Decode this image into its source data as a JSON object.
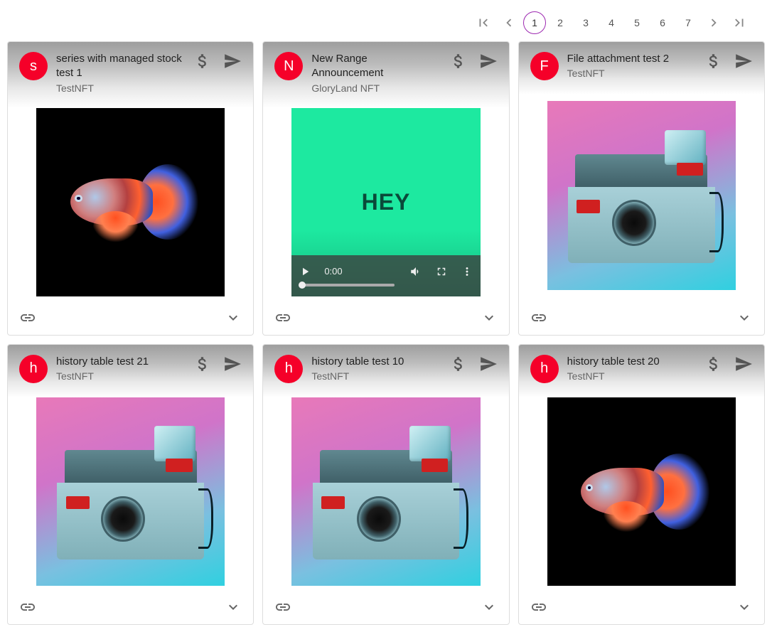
{
  "pagination": {
    "pages": [
      "1",
      "2",
      "3",
      "4",
      "5",
      "6",
      "7"
    ],
    "active": "1"
  },
  "cards": [
    {
      "avatar": "s",
      "title": "series with managed stock test 1",
      "sub": "TestNFT",
      "media": "fish"
    },
    {
      "avatar": "N",
      "title": "New Range Announcement",
      "sub": "GloryLand NFT",
      "media": "video",
      "video_time": "0:00",
      "video_text": "HEY"
    },
    {
      "avatar": "F",
      "title": "File attachment test 2",
      "sub": "TestNFT",
      "media": "camera"
    },
    {
      "avatar": "h",
      "title": "history table test 21",
      "sub": "TestNFT",
      "media": "camera"
    },
    {
      "avatar": "h",
      "title": "history table test 10",
      "sub": "TestNFT",
      "media": "camera"
    },
    {
      "avatar": "h",
      "title": "history table test 20",
      "sub": "TestNFT",
      "media": "fish"
    }
  ]
}
